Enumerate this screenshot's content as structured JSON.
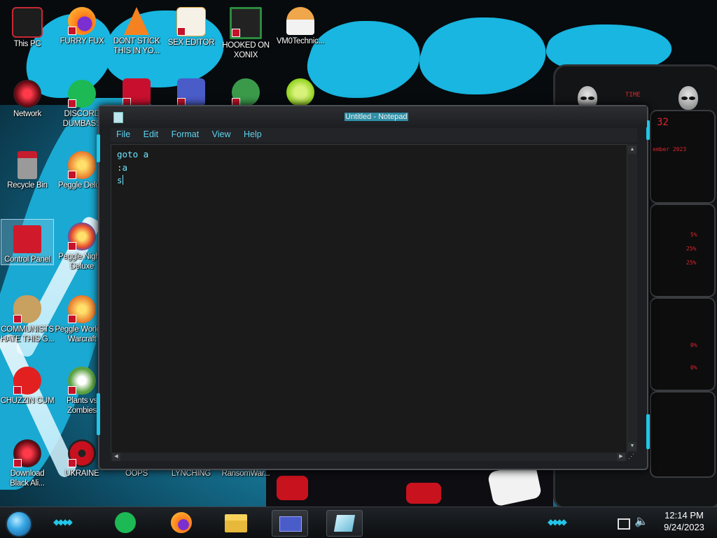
{
  "desktop": {
    "icons": [
      {
        "label": "This PC",
        "icon": "computer-icon",
        "color": "#c62834"
      },
      {
        "label": "FURRY FUX",
        "icon": "firefox-icon",
        "color": "#ff7a18"
      },
      {
        "label": "DONT STICK THIS IN YO...",
        "icon": "vlc-cone-icon",
        "color": "#f58220"
      },
      {
        "label": "SEX EDITOR",
        "icon": "hxd-icon",
        "color": "#d9a441"
      },
      {
        "label": "HOOKED ON XONIX",
        "icon": "xonix-icon",
        "color": "#2b8a3e"
      },
      {
        "label": "VM0Technic...",
        "icon": "doctor-icon",
        "color": "#f0a64b"
      },
      {
        "label": "Network",
        "icon": "alienware-network-icon",
        "color": "#c0162c"
      },
      {
        "label": "DISCORD DUMBASS",
        "icon": "discord-icon",
        "color": "#1db954"
      },
      {
        "label": "Recycle Bin",
        "icon": "recycle-bin-icon",
        "color": "#c51c2e"
      },
      {
        "label": "Peggle Delu...",
        "icon": "peggle-icon",
        "color": "#e8742a"
      },
      {
        "label": "Control Panel",
        "icon": "control-panel-icon",
        "color": "#d01a2b"
      },
      {
        "label": "Peggle Nights Deluxe",
        "icon": "peggle-nights-icon",
        "color": "#e84a2a"
      },
      {
        "label": "COMMUNISTS HATE THIS G...",
        "icon": "money-bag-icon",
        "color": "#c8a060"
      },
      {
        "label": "Peggle World of Warcraft",
        "icon": "peggle-wow-icon",
        "color": "#e8742a"
      },
      {
        "label": "CHUZZIN CUM",
        "icon": "chuzzle-icon",
        "color": "#e22020"
      },
      {
        "label": "Plants vs Zombies",
        "icon": "pvz-icon",
        "color": "#5aa040"
      },
      {
        "label": "Download Black Ali...",
        "icon": "alienware-download-icon",
        "color": "#c0162c"
      },
      {
        "label": "UKRAINE",
        "icon": "radiation-icon",
        "color": "#c8101e"
      },
      {
        "label": "OOPS",
        "icon": "",
        "color": ""
      },
      {
        "label": "LYNCHING",
        "icon": "",
        "color": ""
      },
      {
        "label": "RansomWar...",
        "icon": "",
        "color": ""
      },
      {
        "label": "",
        "icon": "dev-cpp-icon",
        "color": "#c8102e"
      },
      {
        "label": "",
        "icon": "window-app-icon",
        "color": "#4a5cc8"
      },
      {
        "label": "",
        "icon": "santa-game-icon",
        "color": "#3b9a4a"
      },
      {
        "label": "",
        "icon": "lime-icon",
        "color": "#8ed11c"
      }
    ]
  },
  "notepad": {
    "title": "Untitled - Notepad",
    "menu": [
      "File",
      "Edit",
      "Format",
      "View",
      "Help"
    ],
    "content": [
      "goto a",
      ":a",
      "s"
    ],
    "accent": "#22c6e8"
  },
  "widget": {
    "readouts": [
      "TIME",
      "32",
      "ember 2023",
      "5%",
      "25%",
      "25%",
      "0%",
      "0%"
    ]
  },
  "taskbar": {
    "items": [
      "spotify-icon",
      "firefox-icon",
      "file-explorer-icon",
      "window-app-icon",
      "glass-app-icon"
    ],
    "time": "12:14 PM",
    "date": "9/24/2023"
  }
}
